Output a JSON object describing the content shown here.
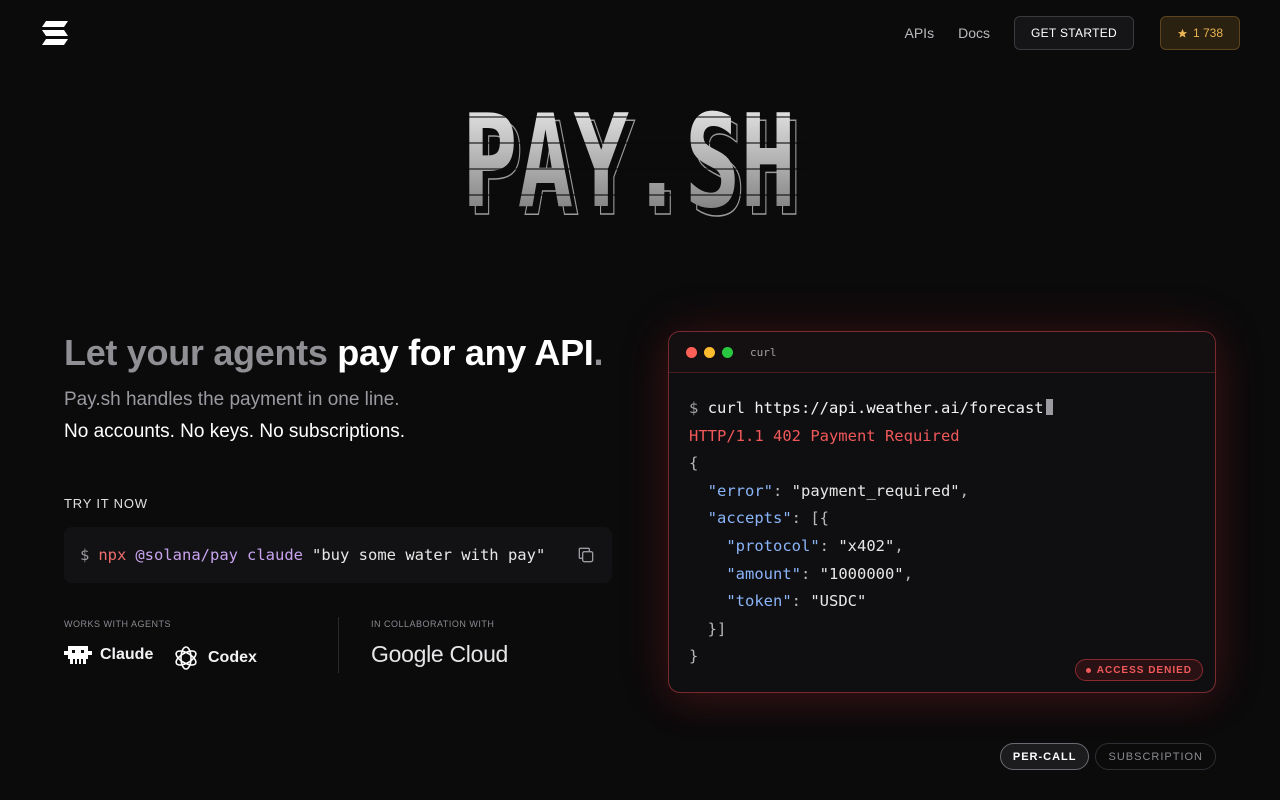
{
  "header": {
    "nav_apis": "APIs",
    "nav_docs": "Docs",
    "get_started": "GET STARTED",
    "stars": "1 738"
  },
  "hero": {
    "title": "PAY.SH"
  },
  "left": {
    "headline_dim": "Let your agents ",
    "headline_bright": "pay for any API",
    "headline_dot": ".",
    "sub1": "Pay.sh handles the payment in one line.",
    "sub2": "No accounts. No keys. No subscriptions.",
    "try_label": "TRY IT NOW",
    "cmd": {
      "dollar": "$",
      "npx": "npx",
      "pkg": "@solana/pay",
      "arg": "claude",
      "str": "\"buy some water with pay\""
    },
    "works_label": "WORKS WITH AGENTS",
    "collab_label": "IN COLLABORATION WITH",
    "agents": [
      "Claude",
      "Codex"
    ],
    "partner": "Google Cloud"
  },
  "terminal": {
    "title": "curl",
    "prompt": "$",
    "command": "curl https://api.weather.ai/forecast",
    "status": "HTTP/1.1 402 Payment Required",
    "json": {
      "error_key": "\"error\"",
      "error_val": "\"payment_required\"",
      "accepts_key": "\"accepts\"",
      "protocol_key": "\"protocol\"",
      "protocol_val": "\"x402\"",
      "amount_key": "\"amount\"",
      "amount_val": "\"1000000\"",
      "token_key": "\"token\"",
      "token_val": "\"USDC\""
    },
    "badge": "ACCESS DENIED"
  },
  "toggle": {
    "active": "PER-CALL",
    "inactive": "SUBSCRIPTION"
  },
  "colors": {
    "accent_red": "#f0585a",
    "star_gold": "#e9b451",
    "key_blue": "#8ab4f8"
  }
}
